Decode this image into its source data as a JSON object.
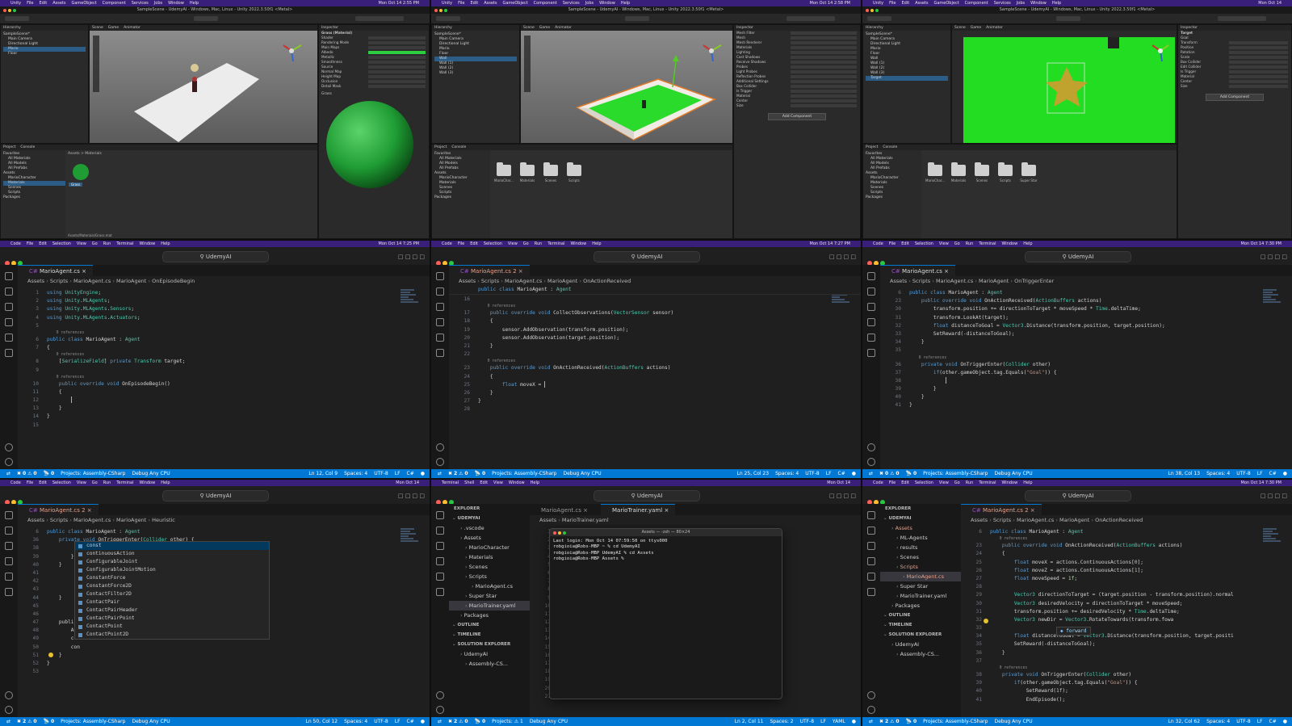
{
  "mac_menu": {
    "unity": [
      "Unity",
      "File",
      "Edit",
      "Assets",
      "GameObject",
      "Component",
      "Services",
      "Jobs",
      "Window",
      "Help"
    ],
    "code": [
      "Code",
      "File",
      "Edit",
      "Selection",
      "View",
      "Go",
      "Run",
      "Terminal",
      "Window",
      "Help"
    ],
    "terminal": [
      "Terminal",
      "Shell",
      "Edit",
      "View",
      "Window",
      "Help"
    ]
  },
  "unity": {
    "window_title": "SampleScene - UdemyAI - Windows, Mac, Linux - Unity 2022.3.50f1 <Metal>",
    "project_tabs": [
      "Project",
      "Console"
    ],
    "scene_tabs": [
      "Scene",
      "Game",
      "Animator"
    ],
    "inspector_tab": "Inspector",
    "hierarchy_tab": "Hierarchy",
    "favorites": [
      "Favorites",
      "All Materials",
      "All Models",
      "All Prefabs"
    ],
    "assets_tree": [
      "Assets",
      "MarioCharacter",
      "Materials",
      "Scenes",
      "Scripts",
      "Packages"
    ],
    "p1": {
      "time": "Mon Oct 14 2:55 PM",
      "hierarchy": [
        "SampleScene*",
        "Main Camera",
        "Directional Light",
        "Mario",
        "Floor"
      ],
      "inspector_title": "Grass (Material)",
      "inspector_rows": [
        "Shader",
        "Rendering Mode",
        "Main Maps",
        "Albedo",
        "Metallic",
        "Smoothness",
        "Source",
        "Normal Map",
        "Height Map",
        "Occlusion",
        "Detail Mask"
      ],
      "preview_label": "Grass",
      "breadcrumb": "Assets > Materials",
      "asset_label": "Grass",
      "footer_path": "Assets/Materials/Grass.mat"
    },
    "p2": {
      "time": "Mon Oct 14 2:58 PM",
      "hierarchy": [
        "SampleScene*",
        "Main Camera",
        "Directional Light",
        "Mario",
        "Floor",
        "Wall",
        "Wall (1)",
        "Wall (2)",
        "Wall (3)"
      ],
      "inspector_rows": [
        "Mesh Filter",
        "Mesh",
        "Mesh Renderer",
        "Materials",
        "Lighting",
        "Cast Shadows",
        "Receive Shadows",
        "Probes",
        "Light Probes",
        "Reflection Probes",
        "Additional Settings",
        "Box Collider",
        "Is Trigger",
        "Material",
        "Center",
        "Size"
      ],
      "add_component": "Add Component",
      "folders": [
        "MarioChar...",
        "Materials",
        "Scenes",
        "Scripts"
      ]
    },
    "p3": {
      "time": "Mon Oct 14",
      "hierarchy": [
        "SampleScene*",
        "Main Camera",
        "Directional Light",
        "Mario",
        "Floor",
        "Wall",
        "Wall (1)",
        "Wall (2)",
        "Wall (3)",
        "Target"
      ],
      "inspector_name": "Target",
      "inspector_tag": "Goal",
      "inspector_rows": [
        "Transform",
        "Position",
        "Rotation",
        "Scale",
        "Box Collider",
        "Edit Collider",
        "Is Trigger",
        "Material",
        "Center",
        "Size"
      ],
      "add_component": "Add Component",
      "folders": [
        "MarioChar...",
        "Materials",
        "Scenes",
        "Scripts",
        "Super Star"
      ]
    }
  },
  "code": {
    "search": "UdemyAI",
    "p4": {
      "time": "Mon Oct 14 7:25 PM",
      "tab": "MarioAgent.cs",
      "breadcrumb": [
        "Assets",
        "Scripts",
        "MarioAgent.cs",
        "MarioAgent",
        "OnEpisodeBegin"
      ],
      "lines": [
        {
          "n": "1",
          "t": "using UnityEngine;"
        },
        {
          "n": "2",
          "t": "using Unity.MLAgents;"
        },
        {
          "n": "3",
          "t": "using Unity.MLAgents.Sensors;"
        },
        {
          "n": "4",
          "t": "using Unity.MLAgents.Actuators;"
        },
        {
          "n": "5",
          "t": ""
        },
        {
          "ref": "0 references"
        },
        {
          "n": "6",
          "t": "public class MarioAgent : Agent"
        },
        {
          "n": "7",
          "t": "{"
        },
        {
          "ref": "0 references"
        },
        {
          "n": "8",
          "t": "    [SerializeField] private Transform target;"
        },
        {
          "n": "9",
          "t": ""
        },
        {
          "ref": "0 references"
        },
        {
          "n": "10",
          "t": "    public override void OnEpisodeBegin()"
        },
        {
          "n": "11",
          "t": "    {"
        },
        {
          "n": "12",
          "t": "        |"
        },
        {
          "n": "13",
          "t": "    }"
        },
        {
          "n": "14",
          "t": "}"
        },
        {
          "n": "15",
          "t": ""
        }
      ],
      "status": {
        "errors": "0",
        "warnings": "0",
        "remote": "0",
        "projects": "Projects: Assembly-CSharp",
        "config": "Debug Any CPU",
        "pos": "Ln 12, Col 9",
        "spaces": "Spaces: 4",
        "enc": "UTF-8",
        "eol": "LF",
        "lang": "C#"
      }
    },
    "p5": {
      "time": "Mon Oct 14 7:27 PM",
      "tab": "MarioAgent.cs 2",
      "breadcrumb": [
        "Assets",
        "Scripts",
        "MarioAgent.cs",
        "MarioAgent",
        "OnActionReceived"
      ],
      "header": "public class MarioAgent : Agent",
      "lines": [
        {
          "n": "16",
          "t": ""
        },
        {
          "ref": "0 references"
        },
        {
          "n": "17",
          "t": "    public override void CollectObservations(VectorSensor sensor)"
        },
        {
          "n": "18",
          "t": "    {"
        },
        {
          "n": "19",
          "t": "        sensor.AddObservation(transform.position);"
        },
        {
          "n": "20",
          "t": "        sensor.AddObservation(target.position);"
        },
        {
          "n": "21",
          "t": "    }"
        },
        {
          "n": "22",
          "t": ""
        },
        {
          "ref": "0 references"
        },
        {
          "n": "23",
          "t": "    public override void OnActionReceived(ActionBuffers actions)"
        },
        {
          "n": "24",
          "t": "    {"
        },
        {
          "n": "25",
          "t": "        float moveX = |"
        },
        {
          "n": "26",
          "t": "    }"
        },
        {
          "n": "27",
          "t": "}"
        },
        {
          "n": "28",
          "t": ""
        }
      ],
      "status": {
        "errors": "2",
        "warnings": "0",
        "remote": "0",
        "projects": "Projects: Assembly-CSharp",
        "config": "Debug Any CPU",
        "pos": "Ln 25, Col 23",
        "spaces": "Spaces: 4",
        "enc": "UTF-8",
        "eol": "LF",
        "lang": "C#"
      }
    },
    "p6": {
      "time": "Mon Oct 14 7:30 PM",
      "tab": "MarioAgent.cs",
      "breadcrumb": [
        "Assets",
        "Scripts",
        "MarioAgent.cs",
        "MarioAgent",
        "OnTriggerEnter"
      ],
      "header": "public class MarioAgent : Agent",
      "lines": [
        {
          "n": "6",
          "t": "public class MarioAgent : Agent"
        },
        {
          "n": "23",
          "t": "    public override void OnActionReceived(ActionBuffers actions)"
        },
        {
          "n": "30",
          "t": "        transform.position += directionToTarget * moveSpeed * Time.deltaTime;"
        },
        {
          "n": "31",
          "t": "        transform.LookAt(target);"
        },
        {
          "n": "32",
          "t": "        float distanceToGoal = Vector3.Distance(transform.position, target.position);"
        },
        {
          "n": "33",
          "t": "        SetReward(-distanceToGoal);"
        },
        {
          "n": "34",
          "t": "    }"
        },
        {
          "n": "35",
          "t": ""
        },
        {
          "ref": "0 references"
        },
        {
          "n": "36",
          "t": "    private void OnTriggerEnter(Collider other)"
        },
        {
          "n": "37",
          "t": "        if(other.gameObject.tag.Equals(\"Goal\")) {"
        },
        {
          "n": "38",
          "t": "            |"
        },
        {
          "n": "39",
          "t": "        }"
        },
        {
          "n": "40",
          "t": "    }"
        },
        {
          "n": "41",
          "t": "}"
        }
      ],
      "status": {
        "errors": "0",
        "warnings": "0",
        "remote": "0",
        "projects": "Projects: Assembly-CSharp",
        "config": "Debug Any CPU",
        "pos": "Ln 38, Col 13",
        "spaces": "Spaces: 4",
        "enc": "UTF-8",
        "eol": "LF",
        "lang": "C#"
      }
    },
    "p7": {
      "time": "Mon Oct 14",
      "tab": "MarioAgent.cs 2",
      "breadcrumb": [
        "Assets",
        "Scripts",
        "MarioAgent.cs",
        "MarioAgent",
        "Heuristic"
      ],
      "lines": [
        {
          "n": "6",
          "t": "public class MarioAgent : Agent"
        },
        {
          "n": "36",
          "t": "    private void OnTriggerEnter(Collider other) {"
        },
        {
          "n": "38",
          "t": "            SetReward(1f);"
        },
        {
          "n": "39",
          "t": "        }"
        },
        {
          "n": "40",
          "t": "    }"
        },
        {
          "n": "41",
          "t": ""
        },
        {
          "n": "42",
          "t": ""
        },
        {
          "n": "43",
          "t": ""
        },
        {
          "n": "44",
          "t": "    }"
        },
        {
          "n": "45",
          "t": ""
        },
        {
          "n": "46",
          "t": ""
        },
        {
          "n": "47",
          "t": "    publi"
        },
        {
          "n": "48",
          "t": "        Act                                        tions;"
        },
        {
          "n": "49",
          "t": "        con"
        },
        {
          "n": "50",
          "t": "        con"
        },
        {
          "n": "51",
          "t": "    }"
        },
        {
          "n": "52",
          "t": "}"
        },
        {
          "n": "53",
          "t": ""
        }
      ],
      "autocomplete": [
        "const",
        "continuousAction",
        "ConfigurableJoint",
        "ConfigurableJointMotion",
        "ConstantForce",
        "ConstantForce2D",
        "ContactFilter2D",
        "ContactPair",
        "ContactPairHeader",
        "ContactPairPoint",
        "ContactPoint",
        "ContactPoint2D"
      ],
      "status": {
        "errors": "2",
        "warnings": "0",
        "remote": "0",
        "projects": "Projects: Assembly-CSharp",
        "config": "Debug Any CPU",
        "pos": "Ln 50, Col 12",
        "spaces": "Spaces: 4",
        "enc": "UTF-8",
        "eol": "LF",
        "lang": "C#"
      }
    },
    "p8": {
      "time": "Mon Oct 14",
      "explorer_title": "EXPLORER",
      "tabs": [
        "MarioAgent.cs",
        "MarioTrainer.yaml"
      ],
      "breadcrumb": [
        "Assets",
        "MarioTrainer.yaml"
      ],
      "tree": [
        "UDEMYAI",
        ".vscode",
        "Assets",
        "MarioCharacter",
        "Materials",
        "Scenes",
        "Scripts",
        "MarioAgent.cs",
        "Super Star",
        "MarioTrainer.yaml",
        "Packages",
        "OUTLINE",
        "TIMELINE",
        "SOLUTION EXPLORER",
        "UdemyAI",
        "Assembly-CS..."
      ],
      "terminal_title": "Assets — -zsh — 80×24",
      "terminal_lines": [
        "Last login: Mon Oct 14 07:59:50 on ttys000",
        "robgioia@Robs-MBP ~ % cd UdemyAI",
        "robgioia@Robs-MBP UdemyAI % cd Assets",
        "robgioia@Robs-MBP Assets % "
      ],
      "yaml_lines": [
        {
          "n": "19",
          "t": "        gamma: 0.99"
        },
        {
          "n": "20",
          "t": "        strength: 1.0"
        },
        {
          "n": "21",
          "t": ""
        }
      ],
      "status": {
        "errors": "2",
        "warnings": "0",
        "remote": "0",
        "projects": "Projects: ⚠ 1",
        "config": "Debug Any CPU",
        "pos": "Ln 2, Col 11",
        "spaces": "Spaces: 2",
        "enc": "UTF-8",
        "eol": "LF",
        "lang": "YAML"
      }
    },
    "p9": {
      "time": "Mon Oct 14 7:30 PM",
      "explorer_title": "EXPLORER",
      "tab": "MarioAgent.cs 2",
      "breadcrumb": [
        "Assets",
        "Scripts",
        "MarioAgent.cs",
        "MarioAgent",
        "OnActionReceived"
      ],
      "tree": [
        "UDEMYAI",
        "Assets",
        "ML-Agents",
        "results",
        "Scenes",
        "Scripts",
        "MarioAgent.cs",
        "Super Star",
        "MarioTrainer.yaml",
        "Packages",
        "OUTLINE",
        "TIMELINE",
        "SOLUTION EXPLORER",
        "UdemyAI",
        "Assembly-CS..."
      ],
      "lines": [
        {
          "n": "6",
          "t": "public class MarioAgent : Agent"
        },
        {
          "ref": "0 references"
        },
        {
          "n": "23",
          "t": "    public override void OnActionReceived(ActionBuffers actions)"
        },
        {
          "n": "24",
          "t": "    {"
        },
        {
          "n": "25",
          "t": "        float moveX = actions.ContinuousActions[0];"
        },
        {
          "n": "26",
          "t": "        float moveZ = actions.ContinuousActions[1];"
        },
        {
          "n": "27",
          "t": "        float moveSpeed = 1f;"
        },
        {
          "n": "28",
          "t": ""
        },
        {
          "n": "29",
          "t": "        Vector3 directionToTarget = (target.position - transform.position).normal"
        },
        {
          "n": "30",
          "t": "        Vector3 desiredVelocity = directionToTarget * moveSpeed;"
        },
        {
          "n": "31",
          "t": "        transform.position += desiredVelocity * Time.deltaTime;"
        },
        {
          "n": "32",
          "t": "        Vector3 newDir = Vector3.RotateTowards(transform.fowa"
        },
        {
          "n": "33",
          "t": ""
        },
        {
          "n": "34",
          "t": "        float distanceToGoal = Vector3.Distance(transform.position, target.positi"
        },
        {
          "n": "35",
          "t": "        SetReward(-distanceToGoal);"
        },
        {
          "n": "36",
          "t": "    }"
        },
        {
          "n": "37",
          "t": ""
        },
        {
          "ref": "0 references"
        },
        {
          "n": "38",
          "t": "    private void OnTriggerEnter(Collider other)"
        },
        {
          "n": "39",
          "t": "        if(other.gameObject.tag.Equals(\"Goal\")) {"
        },
        {
          "n": "40",
          "t": "            SetReward(1f);"
        },
        {
          "n": "41",
          "t": "            EndEpisode();"
        }
      ],
      "suggest": "forward",
      "status": {
        "errors": "2",
        "warnings": "0",
        "remote": "0",
        "projects": "Projects: Assembly-CSharp",
        "config": "Debug Any CPU",
        "pos": "Ln 32, Col 62",
        "spaces": "Spaces: 4",
        "enc": "UTF-8",
        "eol": "LF",
        "lang": "C#"
      }
    }
  }
}
